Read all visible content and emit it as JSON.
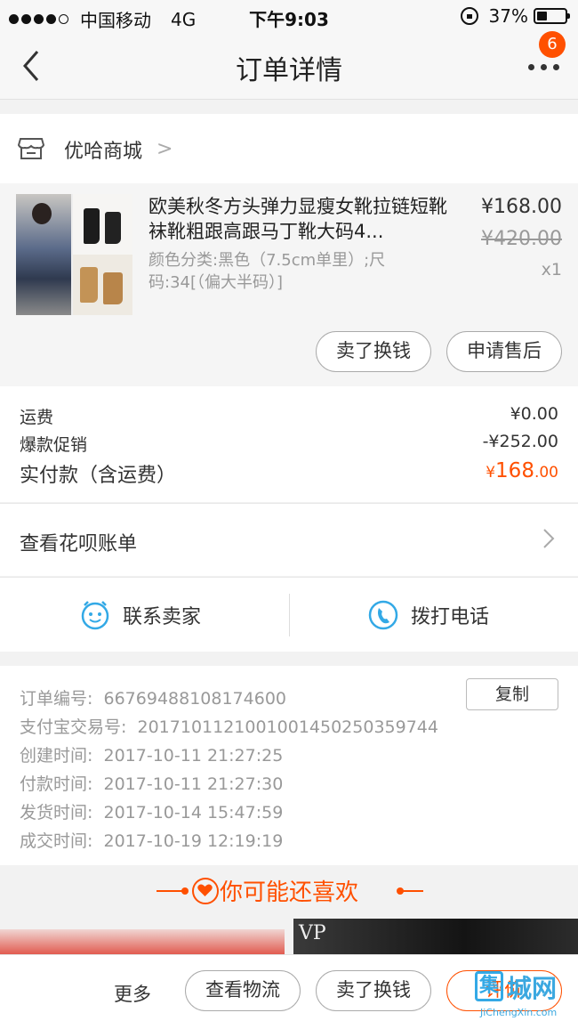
{
  "status_bar": {
    "carrier": "中国移动",
    "network": "4G",
    "time": "下午9:03",
    "battery_text": "37%",
    "battery_level": 0.37
  },
  "nav": {
    "title": "订单详情",
    "badge": "6"
  },
  "shop": {
    "name": "优哈商城"
  },
  "item": {
    "title": "欧美秋冬方头弹力显瘦女靴拉链短靴袜靴粗跟高跟马丁靴大码4...",
    "sku": "颜色分类:黑色（7.5cm单里）;尺码:34[（偏大半码）]",
    "price": "¥168.00",
    "original_price": "¥420.00",
    "quantity": "x1",
    "sell_label": "卖了换钱",
    "aftersale_label": "申请售后"
  },
  "fees": {
    "shipping_label": "运费",
    "shipping_value": "¥0.00",
    "promo_label": "爆款促销",
    "promo_value": "-¥252.00",
    "paid_label": "实付款（含运费）",
    "paid_symbol": "¥",
    "paid_int": "168",
    "paid_dec": ".00"
  },
  "huabei": {
    "label": "查看花呗账单"
  },
  "contact": {
    "seller_label": "联系卖家",
    "phone_label": "拨打电话"
  },
  "order_info": {
    "copy_label": "复制",
    "rows": [
      {
        "label": "订单编号:",
        "value": "66769488108174600"
      },
      {
        "label": "支付宝交易号:",
        "value": "2017101121001001450250359744"
      },
      {
        "label": "创建时间:",
        "value": "2017-10-11 21:27:25"
      },
      {
        "label": "付款时间:",
        "value": "2017-10-11 21:27:30"
      },
      {
        "label": "发货时间:",
        "value": "2017-10-14 15:47:59"
      },
      {
        "label": "成交时间:",
        "value": "2017-10-19 12:19:19"
      }
    ]
  },
  "recommend": {
    "title": "你可能还喜欢",
    "brand_text": "VP"
  },
  "bottom_bar": {
    "more_label": "更多",
    "logistics_label": "查看物流",
    "sell_label": "卖了换钱",
    "review_label": "评价"
  },
  "watermark": {
    "box_char": "集",
    "cn": "城网",
    "en": "JiChengXin.com"
  },
  "colors": {
    "accent": "#ff5000",
    "link_blue": "#33a9e6"
  }
}
